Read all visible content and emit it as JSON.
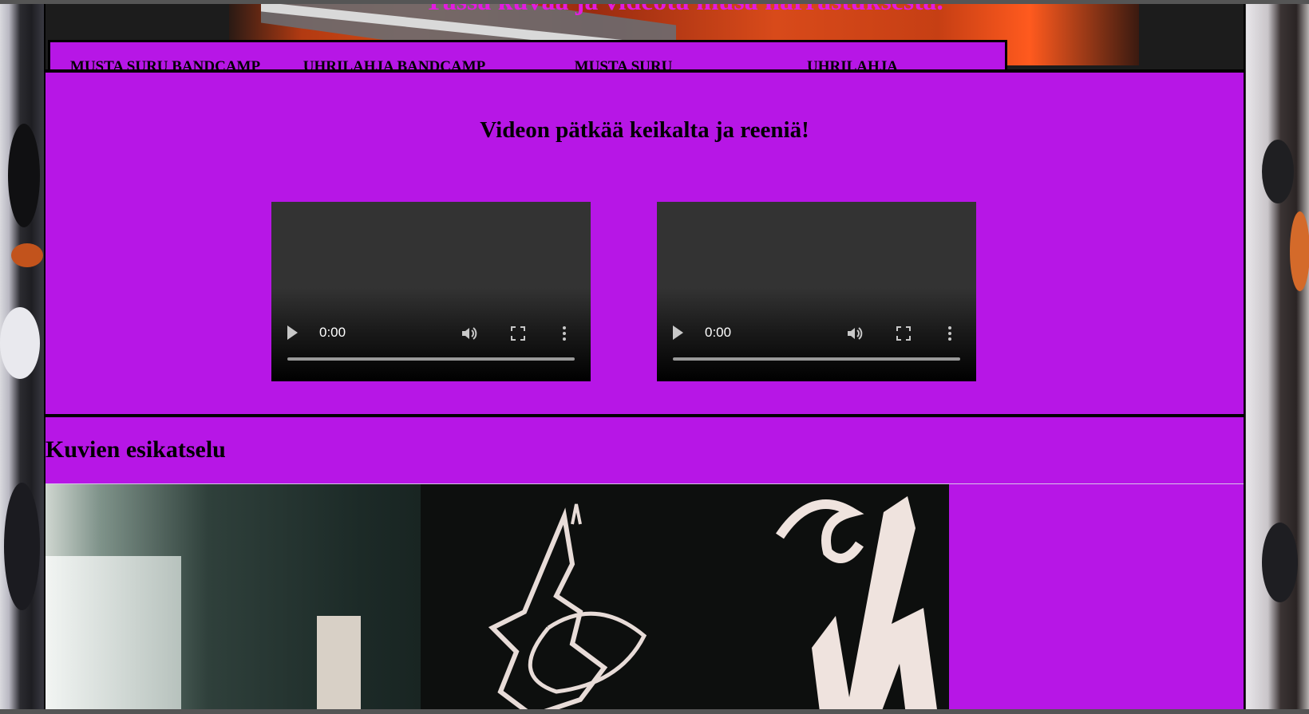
{
  "page": {
    "banner_title": "Tässä kuvaa ja videota musa harrastuksesta."
  },
  "nav": {
    "items": [
      {
        "label": "MUSTA SURU BANDCAMP"
      },
      {
        "label": "UHRILAHJA BANDCAMP"
      },
      {
        "label": "MUSTA SURU"
      },
      {
        "label": "UHRILAHJA"
      }
    ]
  },
  "videos": {
    "heading": "Videon pätkää keikalta ja reeniä!",
    "players": [
      {
        "time": "0:00"
      },
      {
        "time": "0:00"
      }
    ]
  },
  "preview": {
    "heading": "Kuvien esikatselu"
  },
  "colors": {
    "section_bg": "#b716e6",
    "banner_text": "#e21ce0"
  },
  "icons": [
    "play-icon",
    "volume-icon",
    "fullscreen-icon",
    "more-options-icon"
  ]
}
